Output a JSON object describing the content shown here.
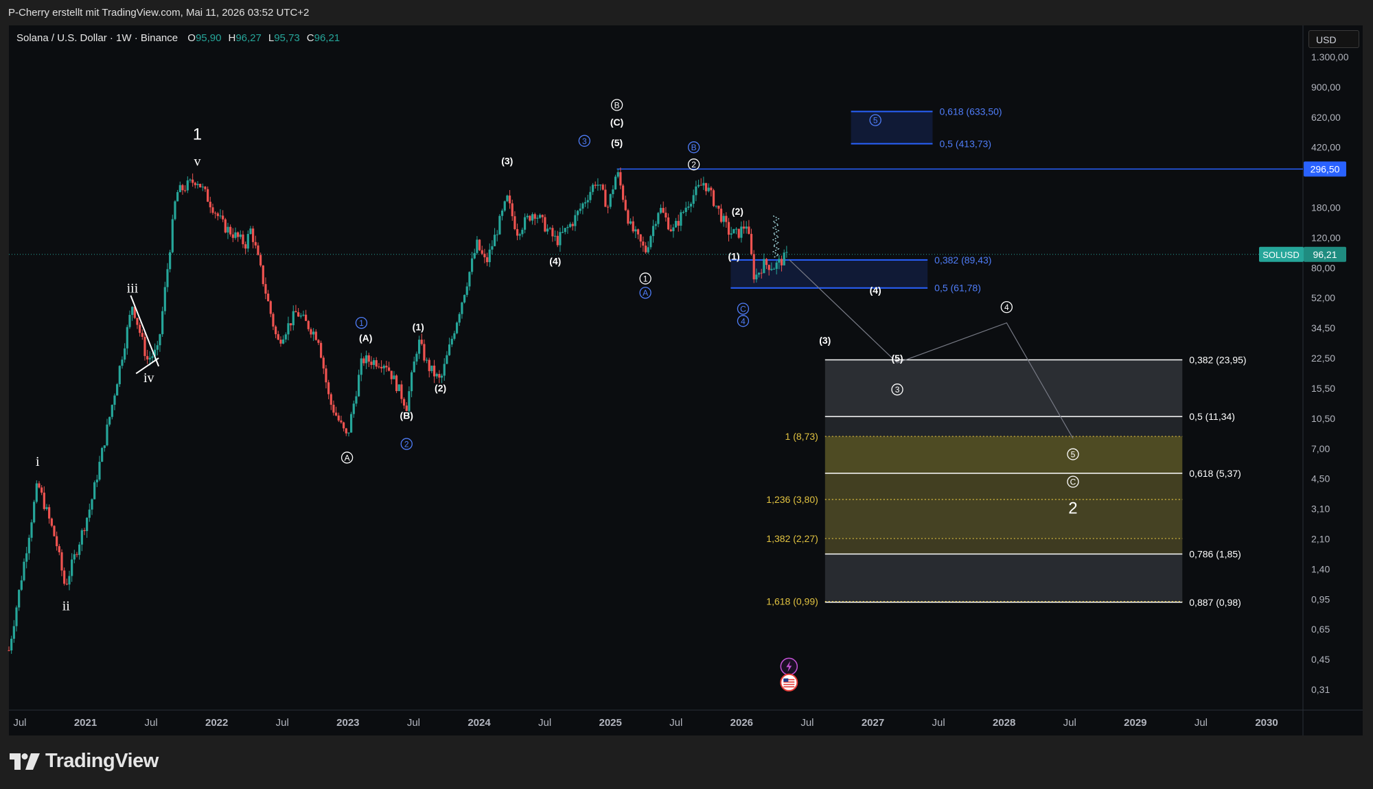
{
  "header": {
    "credit": "P-Cherry erstellt mit TradingView.com, Mai 11, 2026 03:52 UTC+2",
    "symbol": "Solana / U.S. Dollar · 1W · Binance",
    "ohlc": [
      {
        "label": "O",
        "value": "95,90"
      },
      {
        "label": "H",
        "value": "96,27"
      },
      {
        "label": "L",
        "value": "95,73"
      },
      {
        "label": "C",
        "value": "96,21"
      }
    ]
  },
  "toolbar": {
    "currency": "USD"
  },
  "brand": {
    "name": "TradingView"
  },
  "colors": {
    "background": "#0b0d10",
    "page": "#1e1e1e",
    "up": "#26a69a",
    "down": "#ef5350",
    "blue": "#2962ff",
    "fib_gold": "#e2c341",
    "white": "#ffffff"
  },
  "chart_data": {
    "type": "candlestick",
    "scale": "log",
    "ylim": [
      0.28,
      1600
    ],
    "x_axis_labels": [
      "Jul",
      "2021",
      "Jul",
      "2022",
      "Jul",
      "2023",
      "Jul",
      "2024",
      "Jul",
      "2025",
      "Jul",
      "2026",
      "Jul",
      "2027",
      "Jul",
      "2028",
      "Jul",
      "2029",
      "Jul",
      "2030"
    ],
    "y_axis_labels": [
      "1.300,00",
      "900,00",
      "620,00",
      "420,00",
      "296,50",
      "180,00",
      "120,00",
      "80,00",
      "52,00",
      "34,50",
      "22,50",
      "15,50",
      "10,50",
      "7,00",
      "4,50",
      "3,10",
      "2,10",
      "1,40",
      "0,95",
      "0,65",
      "0,45",
      "0,31"
    ],
    "last_price": {
      "symbol": "SOLUSD",
      "value": "96,21",
      "numeric": 96.21
    },
    "resistance": {
      "label": "296,50",
      "value": 296.5
    },
    "price_path": [
      {
        "date": "2020-06-01",
        "price": 0.52
      },
      {
        "date": "2020-08-20",
        "price": 4.7
      },
      {
        "date": "2020-10-10",
        "price": 2.2
      },
      {
        "date": "2020-11-05",
        "price": 1.2
      },
      {
        "date": "2021-01-15",
        "price": 3.5
      },
      {
        "date": "2021-03-10",
        "price": 12
      },
      {
        "date": "2021-05-10",
        "price": 50
      },
      {
        "date": "2021-06-20",
        "price": 24
      },
      {
        "date": "2021-07-20",
        "price": 27
      },
      {
        "date": "2021-09-10",
        "price": 215
      },
      {
        "date": "2021-11-06",
        "price": 260
      },
      {
        "date": "2022-01-20",
        "price": 140
      },
      {
        "date": "2022-03-20",
        "price": 110
      },
      {
        "date": "2022-04-05",
        "price": 135
      },
      {
        "date": "2022-06-18",
        "price": 30
      },
      {
        "date": "2022-08-10",
        "price": 45
      },
      {
        "date": "2022-10-10",
        "price": 32
      },
      {
        "date": "2022-11-10",
        "price": 14
      },
      {
        "date": "2022-12-29",
        "price": 8.5
      },
      {
        "date": "2023-02-10",
        "price": 24
      },
      {
        "date": "2023-04-15",
        "price": 23
      },
      {
        "date": "2023-06-12",
        "price": 13
      },
      {
        "date": "2023-07-14",
        "price": 31
      },
      {
        "date": "2023-08-10",
        "price": 22
      },
      {
        "date": "2023-09-15",
        "price": 18
      },
      {
        "date": "2023-12-25",
        "price": 110
      },
      {
        "date": "2024-01-20",
        "price": 85
      },
      {
        "date": "2024-03-18",
        "price": 200
      },
      {
        "date": "2024-04-15",
        "price": 130
      },
      {
        "date": "2024-06-01",
        "price": 170
      },
      {
        "date": "2024-07-25",
        "price": 120
      },
      {
        "date": "2024-08-05",
        "price": 115
      },
      {
        "date": "2024-09-20",
        "price": 150
      },
      {
        "date": "2024-11-22",
        "price": 255
      },
      {
        "date": "2024-12-25",
        "price": 180
      },
      {
        "date": "2025-01-19",
        "price": 290
      },
      {
        "date": "2025-02-25",
        "price": 140
      },
      {
        "date": "2025-04-07",
        "price": 100
      },
      {
        "date": "2025-05-15",
        "price": 180
      },
      {
        "date": "2025-06-22",
        "price": 130
      },
      {
        "date": "2025-08-10",
        "price": 200
      },
      {
        "date": "2025-09-18",
        "price": 250
      },
      {
        "date": "2025-10-20",
        "price": 185
      },
      {
        "date": "2025-11-25",
        "price": 130
      },
      {
        "date": "2025-12-20",
        "price": 125
      },
      {
        "date": "2026-01-15",
        "price": 145
      },
      {
        "date": "2026-02-06",
        "price": 70
      },
      {
        "date": "2026-03-01",
        "price": 85
      },
      {
        "date": "2026-04-01",
        "price": 82
      },
      {
        "date": "2026-05-11",
        "price": 96.21
      }
    ],
    "wave_labels": [
      {
        "text": "1",
        "date": "2021-11-08",
        "price": 470,
        "style": "big"
      },
      {
        "text": "v",
        "date": "2021-11-08",
        "price": 330,
        "style": "roman"
      },
      {
        "text": "iii",
        "date": "2021-05-10",
        "price": 62,
        "style": "roman"
      },
      {
        "text": "iv",
        "date": "2021-06-25",
        "price": 19,
        "style": "roman"
      },
      {
        "text": "i",
        "date": "2020-08-20",
        "price": 6.3,
        "style": "roman"
      },
      {
        "text": "ii",
        "date": "2020-11-08",
        "price": 0.94,
        "style": "roman"
      },
      {
        "text": "A",
        "date": "2022-12-29",
        "price": 6.6,
        "style": "circle"
      },
      {
        "text": "1",
        "date": "2023-02-08",
        "price": 39,
        "style": "circle-blue"
      },
      {
        "text": "(A)",
        "date": "2023-02-20",
        "price": 32,
        "style": "paren"
      },
      {
        "text": "(1)",
        "date": "2023-07-14",
        "price": 37,
        "style": "paren"
      },
      {
        "text": "(B)",
        "date": "2023-06-12",
        "price": 11.5,
        "style": "paren"
      },
      {
        "text": "2",
        "date": "2023-06-12",
        "price": 7.9,
        "style": "circle-blue"
      },
      {
        "text": "(2)",
        "date": "2023-09-15",
        "price": 16.5,
        "style": "paren"
      },
      {
        "text": "(3)",
        "date": "2024-03-18",
        "price": 330,
        "style": "paren"
      },
      {
        "text": "(4)",
        "date": "2024-07-30",
        "price": 88,
        "style": "paren"
      },
      {
        "text": "3",
        "date": "2024-10-20",
        "price": 430,
        "style": "circle-blue"
      },
      {
        "text": "B",
        "date": "2025-01-19",
        "price": 690,
        "style": "circle"
      },
      {
        "text": "(C)",
        "date": "2025-01-19",
        "price": 550,
        "style": "paren"
      },
      {
        "text": "(5)",
        "date": "2025-01-19",
        "price": 420,
        "style": "paren"
      },
      {
        "text": "1",
        "date": "2025-04-07",
        "price": 70,
        "style": "circle"
      },
      {
        "text": "A",
        "date": "2025-04-07",
        "price": 58,
        "style": "circle-blue"
      },
      {
        "text": "B",
        "date": "2025-08-20",
        "price": 395,
        "style": "circle-blue"
      },
      {
        "text": "2",
        "date": "2025-08-20",
        "price": 315,
        "style": "circle"
      },
      {
        "text": "(2)",
        "date": "2025-12-20",
        "price": 170,
        "style": "paren"
      },
      {
        "text": "(1)",
        "date": "2025-12-10",
        "price": 94,
        "style": "paren"
      },
      {
        "text": "C",
        "date": "2026-01-05",
        "price": 47,
        "style": "circle-blue"
      },
      {
        "text": "4",
        "date": "2026-01-05",
        "price": 40,
        "style": "circle-blue"
      },
      {
        "text": "5",
        "date": "2027-01-08",
        "price": 565,
        "style": "circle-blue"
      },
      {
        "text": "(4)",
        "date": "2027-01-08",
        "price": 60,
        "style": "paren"
      },
      {
        "text": "(3)",
        "date": "2026-08-20",
        "price": 31,
        "style": "paren"
      },
      {
        "text": "(5)",
        "date": "2027-03-08",
        "price": 24.5,
        "style": "paren"
      },
      {
        "text": "3",
        "date": "2027-03-08",
        "price": 16.2,
        "style": "circle"
      },
      {
        "text": "4",
        "date": "2028-01-08",
        "price": 48,
        "style": "circle"
      },
      {
        "text": "5",
        "date": "2028-07-10",
        "price": 6.9,
        "style": "circle"
      },
      {
        "text": "C",
        "date": "2028-07-10",
        "price": 4.8,
        "style": "circle"
      },
      {
        "text": "2",
        "date": "2028-07-10",
        "price": 3.4,
        "style": "big"
      }
    ],
    "projection_path": [
      {
        "date": "2026-05-11",
        "price": 90
      },
      {
        "date": "2027-03-08",
        "price": 23
      },
      {
        "date": "2028-01-08",
        "price": 39
      },
      {
        "date": "2028-07-10",
        "price": 8.5
      }
    ],
    "upper_fib": {
      "zone": [
        413.73,
        633.5
      ],
      "start": "2026-11-01",
      "end": "2027-06-15",
      "levels": [
        {
          "label": "0,618 (633,50)",
          "value": 633.5
        },
        {
          "label": "0,5 (413,73)",
          "value": 413.73
        }
      ]
    },
    "mid_fib": {
      "zone": [
        61.78,
        89.43
      ],
      "start": "2025-12-01",
      "end": "2027-06-01",
      "levels": [
        {
          "label": "0,382 (89,43)",
          "value": 89.43
        },
        {
          "label": "0,5 (61,78)",
          "value": 61.78
        }
      ]
    },
    "lower_fib": {
      "start": "2026-08-20",
      "end": "2029-05-10",
      "retracements": [
        {
          "label": "0,382 (23,95)",
          "value": 23.95
        },
        {
          "label": "0,5 (11,34)",
          "value": 11.34
        },
        {
          "label": "0,618 (5,37)",
          "value": 5.37
        },
        {
          "label": "0,786 (1,85)",
          "value": 1.85
        },
        {
          "label": "0,887 (0,98)",
          "value": 0.98
        }
      ],
      "extensions": [
        {
          "label": "1 (8,73)",
          "value": 8.73
        },
        {
          "label": "1,236 (3,80)",
          "value": 3.8
        },
        {
          "label": "1,382 (2,27)",
          "value": 2.27
        },
        {
          "label": "1,618 (0,99)",
          "value": 0.99
        }
      ]
    },
    "triangle": [
      {
        "date": "2021-05-05",
        "price": 56
      },
      {
        "date": "2021-07-22",
        "price": 22
      },
      {
        "date": "2021-05-20",
        "price": 20
      },
      {
        "date": "2021-07-22",
        "price": 24.5
      }
    ],
    "event_markers": [
      {
        "type": "lightning-icon",
        "date": "2026-05-11",
        "price": 0.42
      },
      {
        "type": "us-flag-icon",
        "date": "2026-05-11",
        "price": 0.34
      }
    ]
  }
}
